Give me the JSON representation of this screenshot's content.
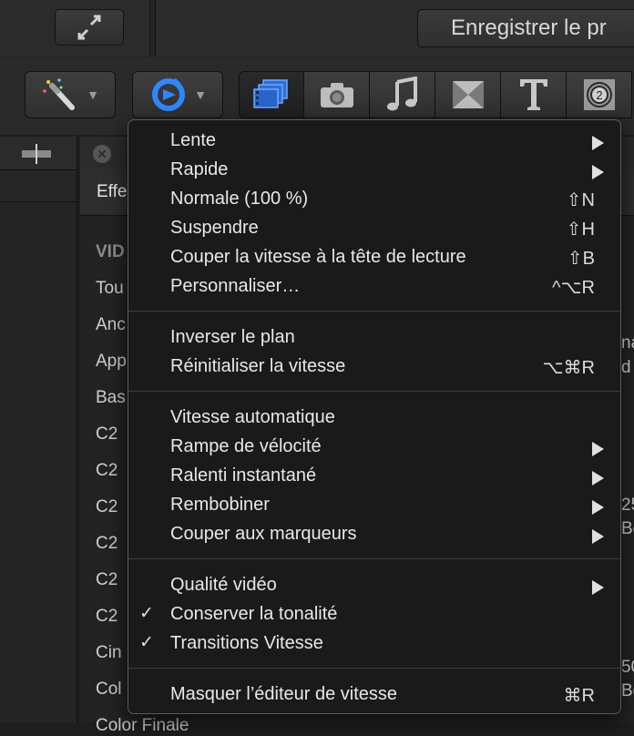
{
  "topbar": {
    "save_label": "Enregistrer le pr"
  },
  "toolbar": {
    "icons": [
      "magic-wand-icon",
      "retime-icon",
      "film-icon",
      "camera-icon",
      "music-icon",
      "transition-icon",
      "title-icon",
      "generator-icon"
    ],
    "accent": "#3a8cff"
  },
  "effects": {
    "tab_label": "Effe",
    "categories": [
      {
        "label": "VID",
        "heading": true
      },
      {
        "label": "Tou"
      },
      {
        "label": "Anc"
      },
      {
        "label": "App"
      },
      {
        "label": "Bas"
      },
      {
        "label": "C2"
      },
      {
        "label": "C2"
      },
      {
        "label": "C2"
      },
      {
        "label": "C2"
      },
      {
        "label": "C2"
      },
      {
        "label": "C2"
      },
      {
        "label": "Cin"
      },
      {
        "label": "Col"
      },
      {
        "label": "Color Finale"
      }
    ],
    "thumb_texts": [
      "na",
      "d",
      "25",
      "Bo",
      "50",
      "Bo"
    ]
  },
  "menu": {
    "items": [
      {
        "label": "Lente",
        "submenu": true
      },
      {
        "label": "Rapide",
        "submenu": true
      },
      {
        "label": "Normale (100 %)",
        "shortcut": "⇧N"
      },
      {
        "label": "Suspendre",
        "shortcut": "⇧H"
      },
      {
        "label": "Couper la vitesse à la tête de lecture",
        "shortcut": "⇧B"
      },
      {
        "label": "Personnaliser…",
        "shortcut": "^⌥R"
      },
      {
        "label": "Inverser le plan"
      },
      {
        "label": "Réinitialiser la vitesse",
        "shortcut": "⌥⌘R"
      },
      {
        "label": "Vitesse automatique"
      },
      {
        "label": "Rampe de vélocité",
        "submenu": true
      },
      {
        "label": "Ralenti instantané",
        "submenu": true
      },
      {
        "label": "Rembobiner",
        "submenu": true
      },
      {
        "label": "Couper aux marqueurs",
        "submenu": true
      },
      {
        "label": "Qualité vidéo",
        "submenu": true
      },
      {
        "label": "Conserver la tonalité",
        "checked": true
      },
      {
        "label": "Transitions Vitesse",
        "checked": true
      },
      {
        "label": "Masquer l’éditeur de vitesse",
        "shortcut": "⌘R"
      }
    ]
  }
}
